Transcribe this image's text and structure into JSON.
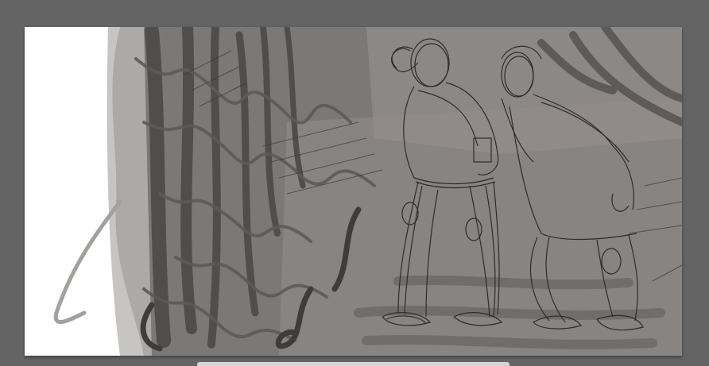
{
  "app": {
    "workspace_color": "#646464",
    "canvas_background": "#ffffff"
  },
  "canvas": {
    "artwork": "sketch-two-figures-forest",
    "palette": {
      "ink": "#2d2d2d",
      "dark_gray": "#4f4e4c",
      "mid_gray": "#6e6b69",
      "light_gray": "#8f8b89",
      "pale_gray": "#b9b7b5"
    }
  },
  "scrollbar": {
    "orientation": "horizontal",
    "thumb_color": "#d4d4d4",
    "position": 0.28
  }
}
